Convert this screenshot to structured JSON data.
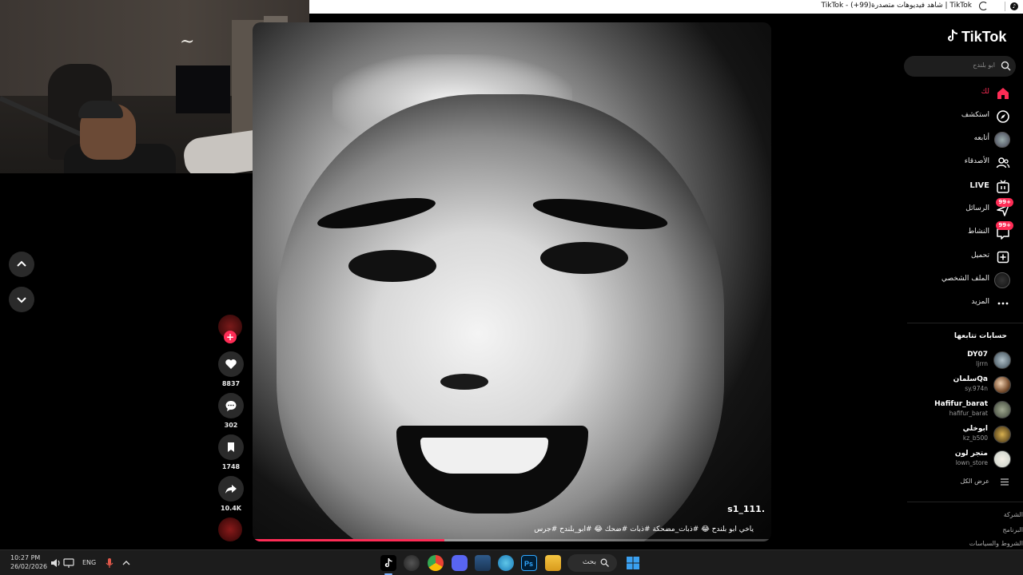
{
  "browser": {
    "title": "TikTok | شاهد فيديوهات متصدرة(99+) - TikTok"
  },
  "nav": {
    "up_icon": "chevron-up-icon",
    "down_icon": "chevron-down-icon"
  },
  "video": {
    "author": "s1_111.",
    "caption": "ياخي ابو بلندح 😂 #ذبات_مضحكة #ذبات #ضحك 😂 #ابو_بلندح #جرس",
    "progress": 0.37
  },
  "actions": {
    "likes": "8837",
    "comments": "302",
    "saves": "1748",
    "shares": "10.4K",
    "follow_symbol": "+"
  },
  "sidebar": {
    "logo": "TikTok",
    "search_placeholder": "ابو بلندح",
    "menu": [
      {
        "label": "لك",
        "icon": "home-icon",
        "active": true
      },
      {
        "label": "استكشف",
        "icon": "compass-icon"
      },
      {
        "label": "أتابعه",
        "icon": "avatar"
      },
      {
        "label": "الأصدقاء",
        "icon": "friends-icon"
      },
      {
        "label": "LIVE",
        "icon": "live-icon"
      },
      {
        "label": "الرسائل",
        "icon": "message-icon",
        "badge": "99+"
      },
      {
        "label": "النشاط",
        "icon": "inbox-icon",
        "badge": "99+"
      },
      {
        "label": "تحميل",
        "icon": "upload-icon"
      },
      {
        "label": "الملف الشخصي",
        "icon": "profile-avatar"
      },
      {
        "label": "المزيد",
        "icon": "more-icon"
      }
    ],
    "following_title": "حسابات تتابعها",
    "following": [
      {
        "name": "DY07",
        "handle": "ljrrn"
      },
      {
        "name": "سلمانQa",
        "handle": "sy.974n"
      },
      {
        "name": "Hafifur_barat",
        "handle": "hafifur_barat"
      },
      {
        "name": "ابوخلي",
        "handle": "kz_b500"
      },
      {
        "name": "متجر لون",
        "handle": "lown_store"
      }
    ],
    "see_all": "عرض الكل",
    "footer": [
      "الشركة",
      "البرنامج",
      "الشروط والسياسات"
    ]
  },
  "taskbar": {
    "time": "10:27 PM",
    "date": "26/02/2026",
    "lang": "ENG",
    "search_label": "بحث"
  },
  "colors": {
    "accent": "#fe2c55",
    "sidebar_bg": "#000000",
    "taskbar_bg": "#1c1c1c"
  }
}
